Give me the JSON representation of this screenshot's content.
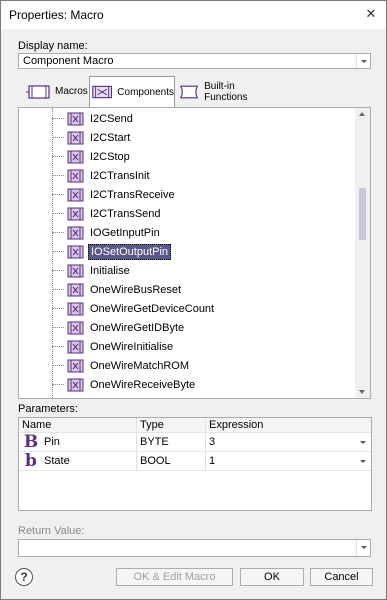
{
  "window": {
    "title": "Properties: Macro"
  },
  "display_name": {
    "label": "Display name:",
    "value": "Component Macro"
  },
  "tabs": [
    {
      "label": "Macros",
      "icon": "macro-icon",
      "active": false
    },
    {
      "label": "Components",
      "icon": "component-icon",
      "active": true
    },
    {
      "label": "Built-in Functions",
      "icon": "function-icon",
      "active": false
    }
  ],
  "tree": {
    "items": [
      {
        "label": "I2CSend"
      },
      {
        "label": "I2CStart"
      },
      {
        "label": "I2CStop"
      },
      {
        "label": "I2CTransInit"
      },
      {
        "label": "I2CTransReceive"
      },
      {
        "label": "I2CTransSend"
      },
      {
        "label": "IOGetInputPin"
      },
      {
        "label": "IOSetOutputPin",
        "selected": true
      },
      {
        "label": "Initialise"
      },
      {
        "label": "OneWireBusReset"
      },
      {
        "label": "OneWireGetDeviceCount"
      },
      {
        "label": "OneWireGetIDByte"
      },
      {
        "label": "OneWireInitialise"
      },
      {
        "label": "OneWireMatchROM"
      },
      {
        "label": "OneWireReceiveByte"
      }
    ]
  },
  "parameters": {
    "label": "Parameters:",
    "columns": [
      "Name",
      "Type",
      "Expression"
    ],
    "rows": [
      {
        "icon_letter": "B",
        "name": "Pin",
        "type": "BYTE",
        "expression": "3"
      },
      {
        "icon_letter": "b",
        "name": "State",
        "type": "BOOL",
        "expression": "1"
      }
    ]
  },
  "return_value": {
    "label": "Return Value:",
    "value": ""
  },
  "buttons": {
    "help": "?",
    "ok_edit": "OK & Edit Macro",
    "ok": "OK",
    "cancel": "Cancel"
  },
  "colors": {
    "accent": "#5a2d82",
    "selection": "#5a5a8a"
  }
}
